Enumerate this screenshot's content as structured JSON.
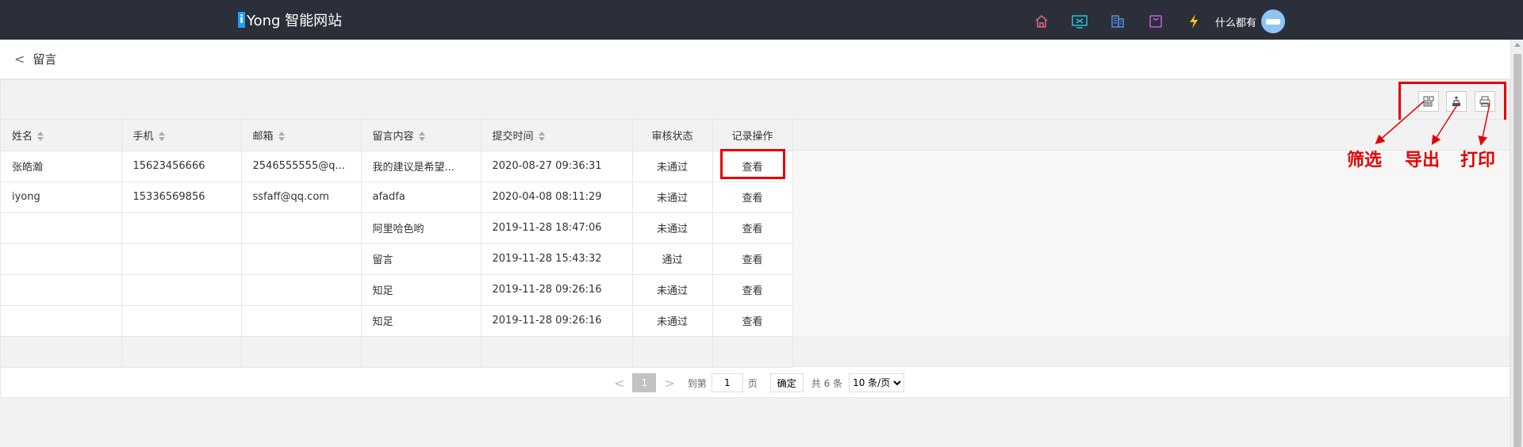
{
  "header": {
    "logo_letter": "i",
    "logo_text": "Yong 智能网站",
    "user_name": "什么都有",
    "icons": [
      "home-icon",
      "monitor-icon",
      "building-icon",
      "bag-icon",
      "lightning-icon"
    ],
    "icon_colors": [
      "#e0667d",
      "#1ec6d8",
      "#5b8de8",
      "#c45ce8",
      "#f5c518"
    ]
  },
  "breadcrumb": {
    "back": "<",
    "title": "留言"
  },
  "toolbar": {
    "icons": [
      "filter-columns-icon",
      "export-icon",
      "print-icon"
    ]
  },
  "table": {
    "columns": [
      "姓名",
      "手机",
      "邮箱",
      "留言内容",
      "提交时间",
      "审核状态",
      "记录操作"
    ],
    "rows": [
      {
        "name": "张皓瀚",
        "phone": "15623456666",
        "email": "2546555555@q...",
        "content": "我的建议是希望...",
        "time": "2020-08-27 09:36:31",
        "status": "未通过",
        "action": "查看"
      },
      {
        "name": "iyong",
        "phone": "15336569856",
        "email": "ssfaff@qq.com",
        "content": "afadfa",
        "time": "2020-04-08 08:11:29",
        "status": "未通过",
        "action": "查看"
      },
      {
        "name": "",
        "phone": "",
        "email": "",
        "content": "阿里哈色哟",
        "time": "2019-11-28 18:47:06",
        "status": "未通过",
        "action": "查看"
      },
      {
        "name": "",
        "phone": "",
        "email": "",
        "content": "留言",
        "time": "2019-11-28 15:43:32",
        "status": "通过",
        "action": "查看"
      },
      {
        "name": "",
        "phone": "",
        "email": "",
        "content": "知足",
        "time": "2019-11-28 09:26:16",
        "status": "未通过",
        "action": "查看"
      },
      {
        "name": "",
        "phone": "",
        "email": "",
        "content": "知足",
        "time": "2019-11-28 09:26:16",
        "status": "未通过",
        "action": "查看"
      }
    ]
  },
  "pager": {
    "prev": "<",
    "current": "1",
    "next": ">",
    "goto_label": "到第",
    "goto_value": "1",
    "page_label": "页",
    "confirm": "确定",
    "total": "共 6 条",
    "page_size": "10 条/页"
  },
  "annotations": {
    "filter": "筛选",
    "export": "导出",
    "print": "打印"
  }
}
